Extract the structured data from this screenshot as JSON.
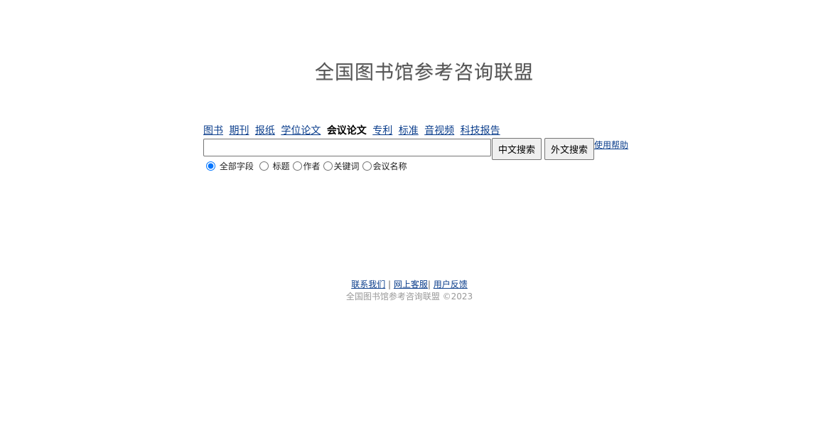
{
  "logo": {
    "text": "全国图书馆参考咨询联盟"
  },
  "nav": {
    "items": [
      {
        "label": "图书",
        "active": false
      },
      {
        "label": "期刊",
        "active": false
      },
      {
        "label": "报纸",
        "active": false
      },
      {
        "label": "学位论文",
        "active": false
      },
      {
        "label": "会议论文",
        "active": true
      },
      {
        "label": "专利",
        "active": false
      },
      {
        "label": "标准",
        "active": false
      },
      {
        "label": "音视频",
        "active": false
      },
      {
        "label": "科技报告",
        "active": false
      }
    ]
  },
  "search": {
    "value": "",
    "chinese_button": "中文搜索",
    "foreign_button": "外文搜索",
    "help_link": "使用帮助"
  },
  "fields": {
    "selected": "全部字段",
    "options": [
      "全部字段",
      "标题",
      "作者",
      "关键词",
      "会议名称"
    ]
  },
  "footer": {
    "contact": "联系我们",
    "separator": "|",
    "online_service": "网上客服",
    "feedback": "用户反馈",
    "copyright": "全国图书馆参考咨询联盟 ©2023"
  },
  "colors": {
    "link": "#0b3e8c",
    "logo": "#555555",
    "copyright": "#999999"
  }
}
